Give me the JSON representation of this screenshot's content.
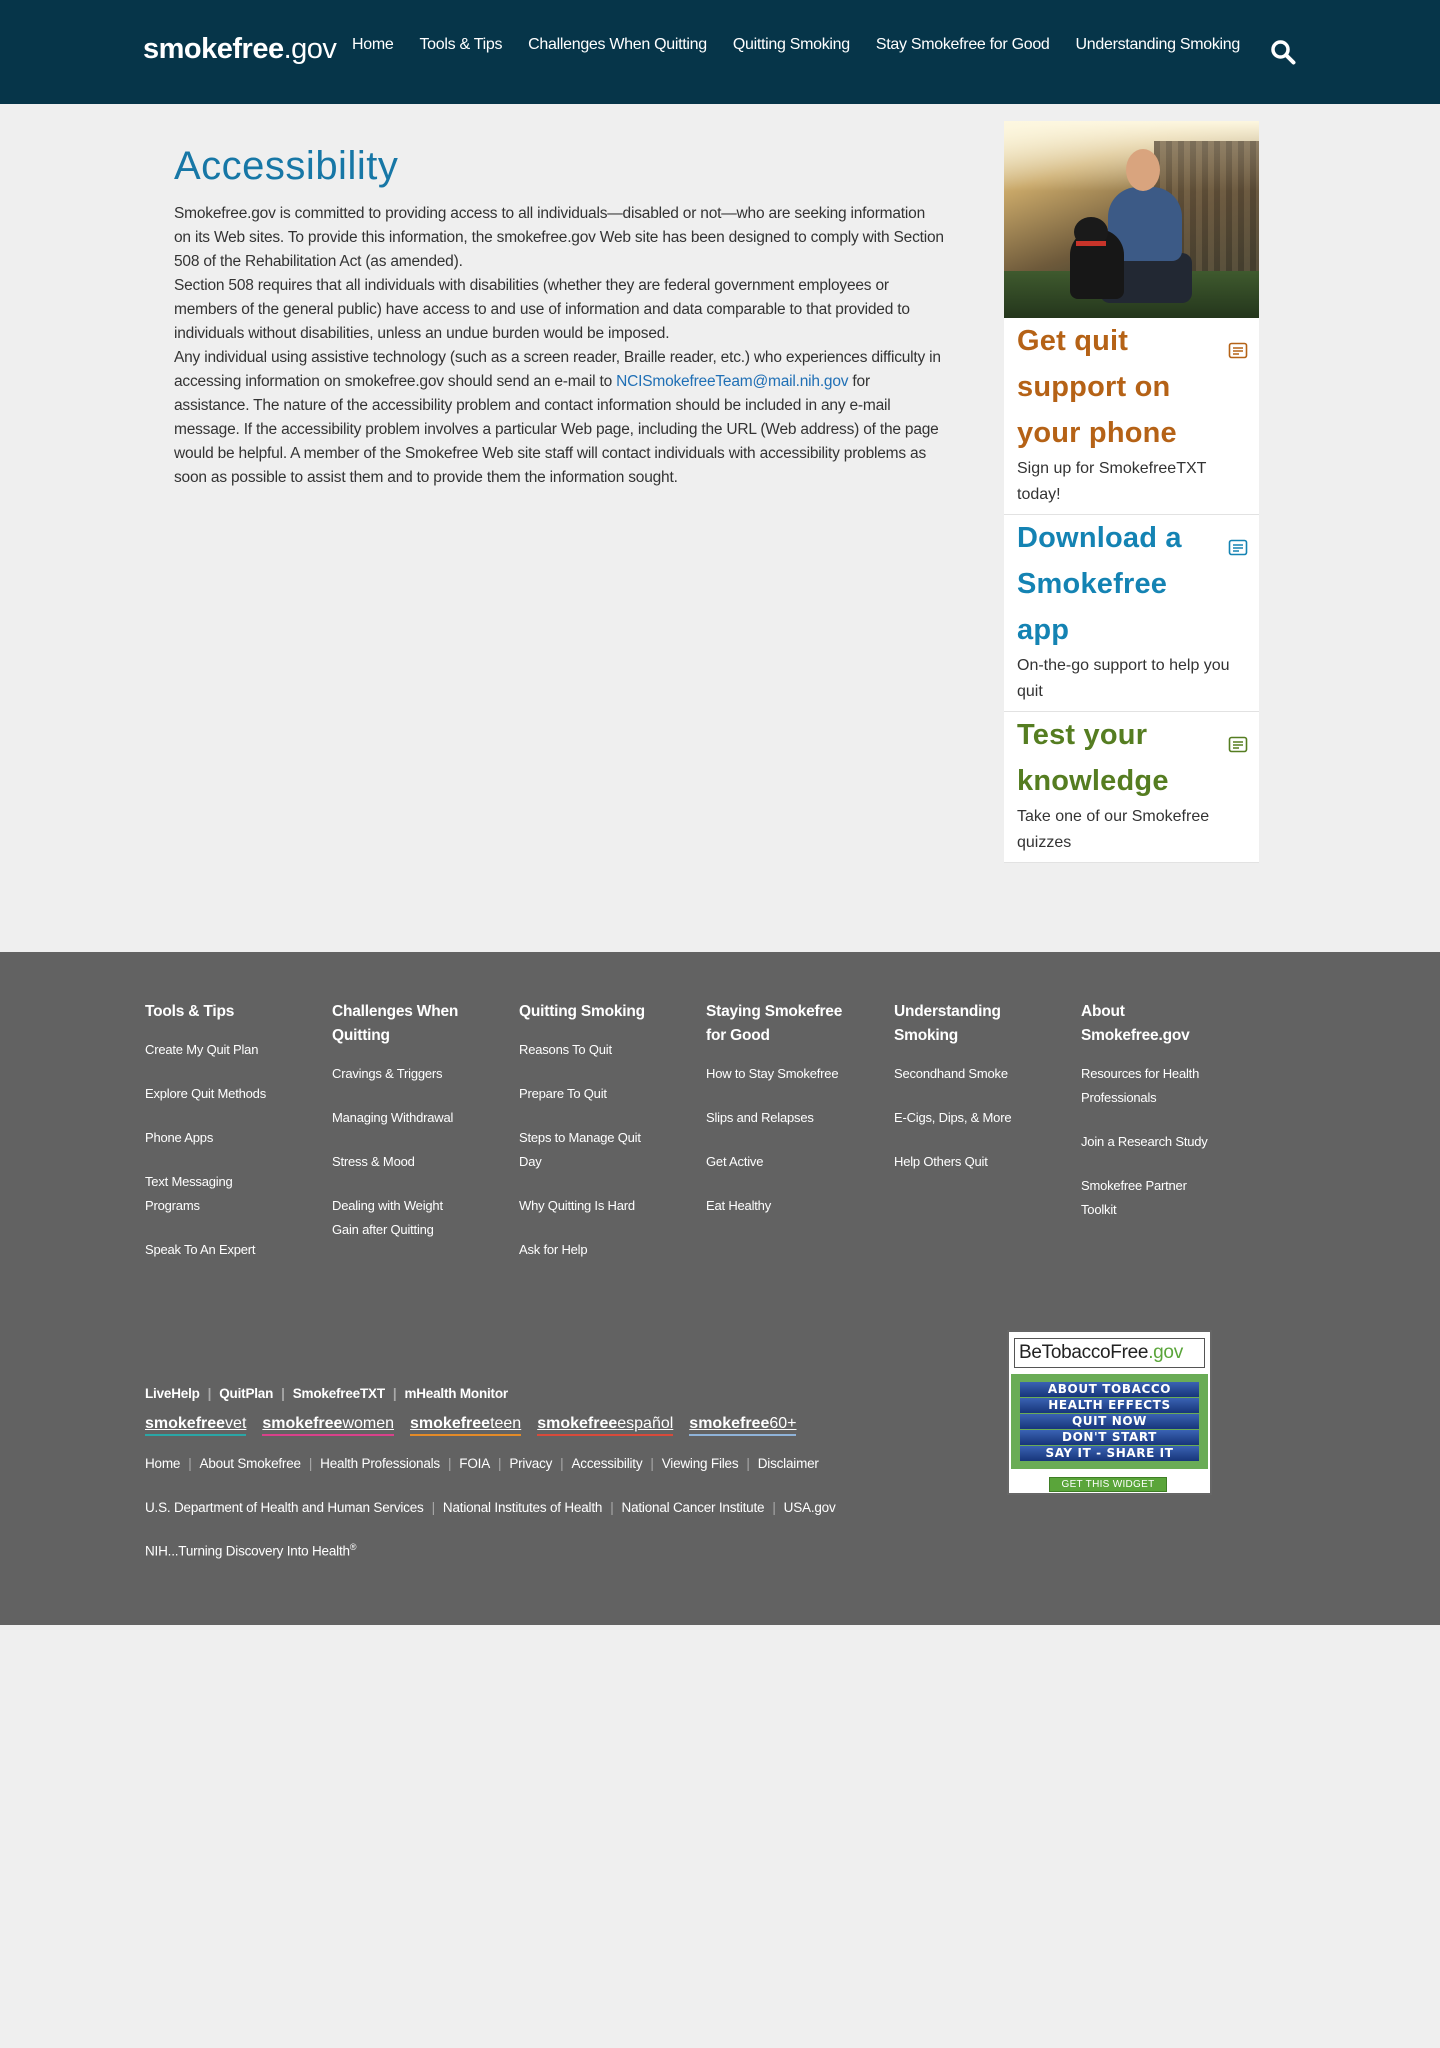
{
  "header": {
    "logo_bold": "smokefree",
    "logo_light": ".gov",
    "nav": [
      "Home",
      "Tools & Tips",
      "Challenges When Quitting",
      "Quitting Smoking",
      "Stay Smokefree for Good",
      "Understanding Smoking"
    ],
    "search_icon": "search-icon"
  },
  "main": {
    "title": "Accessibility",
    "p1": "Smokefree.gov is committed to providing access to all individuals—disabled or not—who are seeking information on its Web sites. To provide this information, the smokefree.gov Web site has been designed to comply with Section 508 of the Rehabilitation Act (as amended).",
    "p2": "Section 508 requires that all individuals with disabilities (whether they are federal government employees or members of the general public) have access to and use of information and data comparable to that provided to individuals without disabilities, unless an undue burden would be imposed.",
    "p3_before": "Any individual using assistive technology (such as a screen reader, Braille reader, etc.) who experiences difficulty in accessing information on smokefree.gov should send an e-mail to ",
    "p3_link": "NCISmokefreeTeam@mail.nih.gov",
    "p3_after": " for assistance. The nature of the accessibility problem and contact information should be included in any e-mail message. If the accessibility problem involves a particular Web page, including the URL (Web address) of the page would be helpful. A member of the Smokefree Web site staff will contact individuals with accessibility problems as soon as possible to assist them and to provide them the information sought."
  },
  "sidebar": {
    "cards": [
      {
        "title": "Get quit support on your phone",
        "desc": "Sign up for SmokefreeTXT today!",
        "color": "#b56216"
      },
      {
        "title": "Download a Smokefree app",
        "desc": "On-the-go support to help you quit",
        "color": "#1483b3"
      },
      {
        "title": "Test your knowledge",
        "desc": "Take one of our Smokefree quizzes",
        "color": "#557d21"
      }
    ]
  },
  "footer": {
    "columns": [
      {
        "heading": "Tools & Tips",
        "links": [
          "Create My Quit Plan",
          "Explore Quit Methods",
          "Phone Apps",
          "Text Messaging Programs",
          "Speak To An Expert"
        ]
      },
      {
        "heading": "Challenges When Quitting",
        "links": [
          "Cravings & Triggers",
          "Managing Withdrawal",
          "Stress & Mood",
          "Dealing with Weight Gain after Quitting"
        ]
      },
      {
        "heading": "Quitting Smoking",
        "links": [
          "Reasons To Quit",
          "Prepare To Quit",
          "Steps to Manage Quit Day",
          "Why Quitting Is Hard",
          "Ask for Help"
        ]
      },
      {
        "heading": "Staying Smokefree for Good",
        "links": [
          "How to Stay Smokefree",
          "Slips and Relapses",
          "Get Active",
          "Eat Healthy"
        ]
      },
      {
        "heading": "Understanding Smoking",
        "links": [
          "Secondhand Smoke",
          "E-Cigs, Dips, & More",
          "Help Others Quit"
        ]
      },
      {
        "heading": "About Smokefree.gov",
        "links": [
          "Resources for Health Professionals",
          "Join a Research Study",
          "Smokefree Partner Toolkit"
        ]
      }
    ],
    "programs": [
      "LiveHelp",
      "QuitPlan",
      "SmokefreeTXT",
      "mHealth Monitor"
    ],
    "brands": [
      {
        "bold": "smokefree",
        "light": "vet"
      },
      {
        "bold": "smokefree",
        "light": "women"
      },
      {
        "bold": "smokefree",
        "light": "teen"
      },
      {
        "bold": "smokefree",
        "light": "español"
      },
      {
        "bold": "smokefree",
        "light": "60+"
      }
    ],
    "site_links": [
      "Home",
      "About Smokefree",
      "Health Professionals",
      "FOIA",
      "Privacy",
      "Accessibility",
      "Viewing Files",
      "Disclaimer"
    ],
    "gov_links": [
      "U.S. Department of Health and Human Services",
      "National Institutes of Health",
      "National Cancer Institute",
      "USA.gov"
    ],
    "tagline": "NIH...Turning Discovery Into Health",
    "tagline_mark": "®",
    "widget": {
      "title_a": "BeTobaccoFree",
      "title_b": ".gov",
      "items": [
        "ABOUT TOBACCO",
        "HEALTH EFFECTS",
        "QUIT NOW",
        "DON'T START",
        "SAY IT - SHARE IT"
      ],
      "button": "GET THIS WIDGET"
    }
  }
}
